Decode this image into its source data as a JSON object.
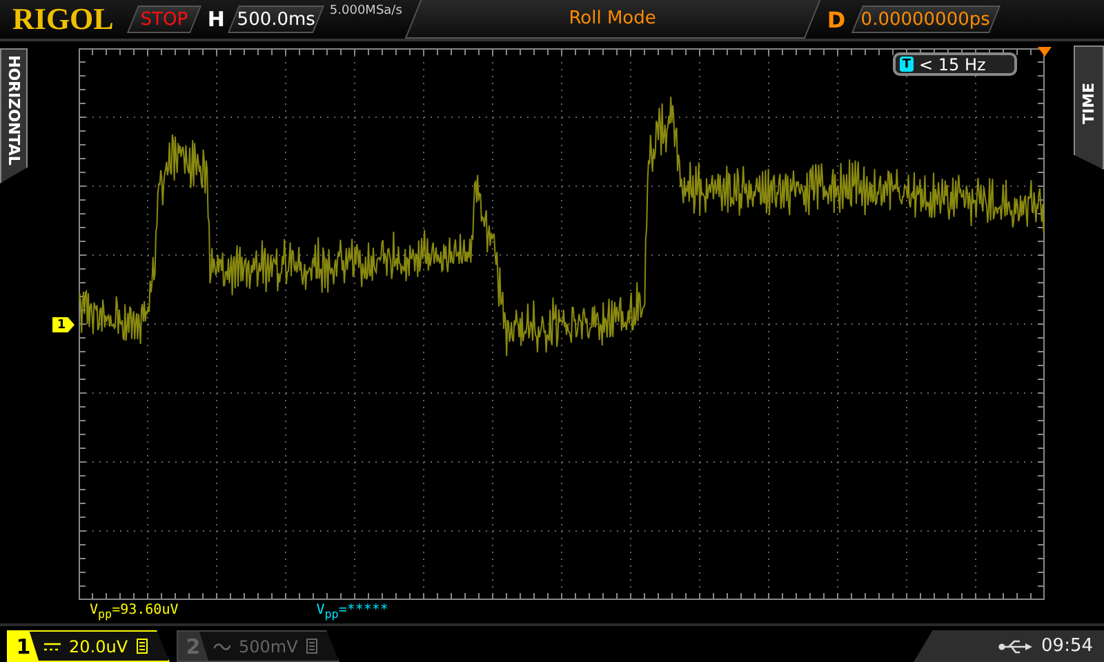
{
  "header": {
    "logo": "RIGOL",
    "run_state": "STOP",
    "h_label": "H",
    "timebase": "500.0ms",
    "sample_rate": "5.000MSa/s",
    "mode": "Roll Mode",
    "d_label": "D",
    "delay": "0.00000000ps"
  },
  "side_tabs": {
    "left": "HORIZONTAL",
    "right": "TIME"
  },
  "trigger": {
    "source": "T",
    "text": "< 15 Hz"
  },
  "channel_marker": "1",
  "measurements": [
    {
      "label": "V$_{pp}$=",
      "value": "93.60uV",
      "color": "#ffff00"
    },
    {
      "label": "V$_{pp}$=",
      "value": "*****",
      "color": "#00e5ff"
    }
  ],
  "channels": [
    {
      "number": "1",
      "kind": "dc",
      "scale": "20.0uV",
      "active": true
    },
    {
      "number": "2",
      "kind": "ac",
      "scale": "500mV",
      "active": false
    }
  ],
  "status": {
    "time": "09:54"
  }
}
